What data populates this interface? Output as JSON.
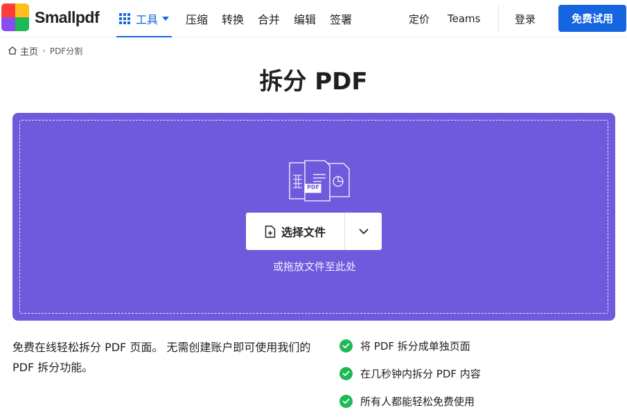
{
  "header": {
    "brand": "Smallpdf",
    "logo_colors": [
      "#ff3c3c",
      "#ffbe19",
      "#1db954",
      "#1565e0",
      "#8a4cf0",
      "#ff4fb4"
    ],
    "nav": {
      "tools_label": "工具",
      "items": [
        "压缩",
        "转换",
        "合并",
        "编辑",
        "签署"
      ],
      "pricing": "定价",
      "teams": "Teams",
      "login": "登录",
      "trial": "免费试用"
    },
    "icons": [
      "grid-icon",
      "caret-down-icon"
    ]
  },
  "breadcrumb": {
    "home": "主页",
    "current": "PDF分割"
  },
  "page_title": "拆分 PDF",
  "dropzone": {
    "choose_label": "选择文件",
    "drop_hint": "或拖放文件至此处",
    "badge": "PDF",
    "bg_color": "#6f5add"
  },
  "description": "免费在线轻松拆分 PDF 页面。 无需创建账户即可使用我们的 PDF 拆分功能。",
  "features": [
    "将 PDF 拆分成单独页面",
    "在几秒钟内拆分 PDF 内容",
    "所有人都能轻松免费使用"
  ],
  "colors": {
    "primary": "#1565e0",
    "success": "#1db954"
  }
}
